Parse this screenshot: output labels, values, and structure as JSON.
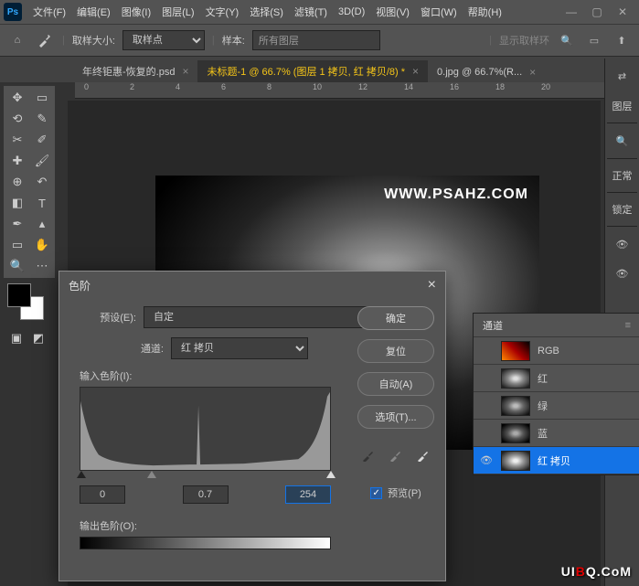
{
  "app": {
    "logo": "Ps"
  },
  "menubar": [
    "文件(F)",
    "编辑(E)",
    "图像(I)",
    "图层(L)",
    "文字(Y)",
    "选择(S)",
    "滤镜(T)",
    "3D(D)",
    "视图(V)",
    "窗口(W)",
    "帮助(H)"
  ],
  "optbar": {
    "sample_size_label": "取样大小:",
    "sample_size_value": "取样点",
    "sample_label": "样本:",
    "all_layers": "所有图层",
    "show_ring": "显示取样环"
  },
  "tabs": [
    {
      "label": "年终钜惠-恢复的.psd",
      "active": false
    },
    {
      "label": "未标题-1 @ 66.7% (图层 1 拷贝, 红 拷贝/8) *",
      "active": true
    },
    {
      "label": "0.jpg @ 66.7%(R...",
      "active": false
    }
  ],
  "ruler": [
    "0",
    "2",
    "4",
    "6",
    "8",
    "10",
    "12",
    "14",
    "16",
    "18",
    "20"
  ],
  "canvas": {
    "watermark_text": "WWW.PSAHZ.COM"
  },
  "levels": {
    "title": "色阶",
    "preset_label": "预设(E):",
    "preset_value": "自定",
    "channel_label": "通道:",
    "channel_value": "红 拷贝",
    "input_label": "输入色阶(I):",
    "input_black": "0",
    "input_gamma": "0.7",
    "input_white": "254",
    "output_label": "输出色阶(O):",
    "buttons": {
      "ok": "确定",
      "reset": "复位",
      "auto": "自动(A)",
      "options": "选项(T)..."
    },
    "preview_label": "预览(P)"
  },
  "channels_panel": {
    "title": "通道",
    "rows": [
      {
        "eye": false,
        "name": "RGB",
        "thumb": "rgb",
        "selected": false
      },
      {
        "eye": false,
        "name": "红",
        "thumb": "red",
        "selected": false
      },
      {
        "eye": false,
        "name": "绿",
        "thumb": "green",
        "selected": false
      },
      {
        "eye": false,
        "name": "蓝",
        "thumb": "blue",
        "selected": false
      },
      {
        "eye": true,
        "name": "红 拷贝",
        "thumb": "copy",
        "selected": true
      }
    ]
  },
  "right_panel": {
    "tab1": "图层",
    "mode": "正常",
    "lock": "锁定"
  },
  "watermark": {
    "t1": "UI",
    "b": "B",
    "q": "Q",
    "t2": ".CoM"
  }
}
